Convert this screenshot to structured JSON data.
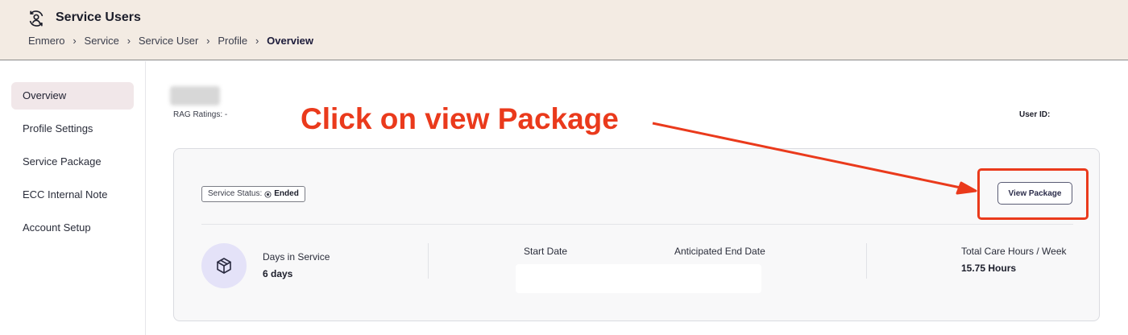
{
  "header": {
    "title": "Service Users",
    "icon": "users-cycle-icon",
    "breadcrumb": [
      "Enmero",
      "Service",
      "Service User",
      "Profile",
      "Overview"
    ]
  },
  "sidebar": {
    "items": [
      {
        "label": "Overview",
        "active": true
      },
      {
        "label": "Profile Settings",
        "active": false
      },
      {
        "label": "Service Package",
        "active": false
      },
      {
        "label": "ECC Internal Note",
        "active": false
      },
      {
        "label": "Account Setup",
        "active": false
      }
    ]
  },
  "profile": {
    "rag_ratings": "RAG Ratings: -",
    "user_id_label": "User ID:"
  },
  "card": {
    "status_label": "Service Status:",
    "status_value": "Ended",
    "view_package_label": "View Package",
    "days_in_service_label": "Days in Service",
    "days_in_service_value": "6 days",
    "start_date_label": "Start Date",
    "anticipated_end_label": "Anticipated End Date",
    "total_care_label": "Total Care Hours / Week",
    "total_care_value": "15.75 Hours"
  },
  "annotation": {
    "text": "Click on view Package",
    "color": "#ea3a1c"
  },
  "colors": {
    "header_bg": "#f3ebe3",
    "active_nav_bg": "#f1e7e9",
    "package_circle_bg": "#e4e2f8"
  }
}
